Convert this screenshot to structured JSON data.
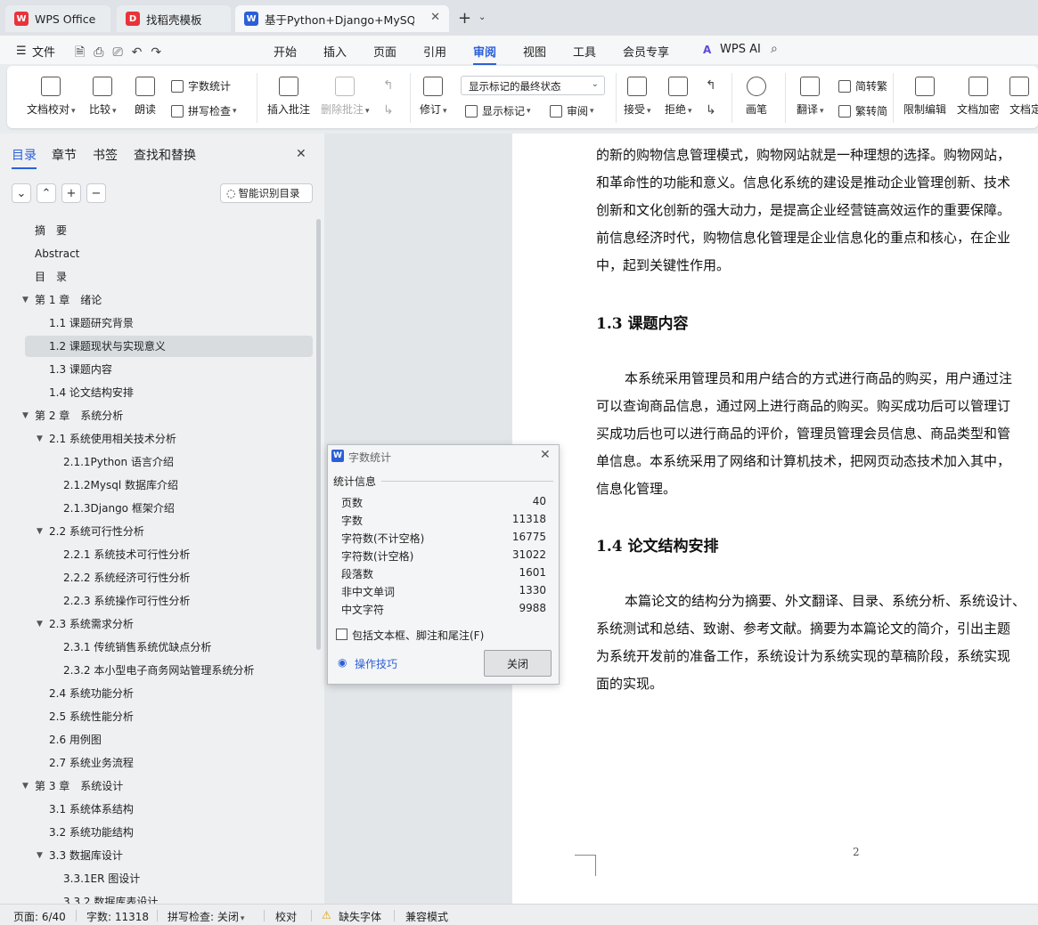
{
  "tabs": [
    {
      "label": "WPS Office",
      "icon": "wps-logo-icon"
    },
    {
      "label": "找稻壳模板",
      "icon": "docer-icon"
    },
    {
      "label": "基于Python+Django+MySQ",
      "icon": "writer-icon"
    }
  ],
  "menu": [
    "文件",
    "开始",
    "插入",
    "页面",
    "引用",
    "审阅",
    "视图",
    "工具",
    "会员专享",
    "WPS AI"
  ],
  "ribbon": {
    "doc_check": "文档校对",
    "compare": "比较",
    "read_aloud": "朗读",
    "word_count": "字数统计",
    "spell_check": "拼写检查",
    "insert_comment": "插入批注",
    "delete_comment": "删除批注",
    "revise": "修订",
    "markup_state": "显示标记的最终状态",
    "show_markup": "显示标记",
    "review_pane": "审阅",
    "accept": "接受",
    "reject": "拒绝",
    "pen": "画笔",
    "translate": "翻译",
    "to_traditional": "简转繁",
    "to_simplified": "繁转简",
    "restrict_edit": "限制编辑",
    "encrypt": "文档加密",
    "finalize": "文档定"
  },
  "nav": {
    "tabs": [
      "目录",
      "章节",
      "书签",
      "查找和替换"
    ],
    "smart_toc": "智能识别目录",
    "items": [
      "摘　要",
      "Abstract",
      "目　录",
      "第 1 章　绪论",
      "1.1 课题研究背景",
      "1.2 课题现状与实现意义",
      "1.3 课题内容",
      "1.4 论文结构安排",
      "第 2 章　系统分析",
      "2.1 系统使用相关技术分析",
      "2.1.1Python 语言介绍",
      "2.1.2Mysql 数据库介绍",
      "2.1.3Django 框架介绍",
      "2.2 系统可行性分析",
      "2.2.1 系统技术可行性分析",
      "2.2.2 系统经济可行性分析",
      "2.2.3 系统操作可行性分析",
      "2.3 系统需求分析",
      "2.3.1 传统销售系统优缺点分析",
      "2.3.2 本小型电子商务网站管理系统分析",
      "2.4 系统功能分析",
      "2.5 系统性能分析",
      "2.6 用例图",
      "2.7 系统业务流程",
      "第 3 章　系统设计",
      "3.1 系统体系结构",
      "3.2 系统功能结构",
      "3.3 数据库设计",
      "3.3.1ER 图设计",
      "3.3.2 数据库表设计"
    ]
  },
  "document": {
    "lines_a": [
      "的新的购物信息管理模式，购物网站就是一种理想的选择。购物网站，",
      "和革命性的功能和意义。信息化系统的建设是推动企业管理创新、技术",
      "创新和文化创新的强大动力，是提高企业经营链高效运作的重要保障。",
      "前信息经济时代，购物信息化管理是企业信息化的重点和核心，在企业",
      "中，起到关键性作用。"
    ],
    "heading_13": "1.3 课题内容",
    "lines_b": [
      "本系统采用管理员和用户结合的方式进行商品的购买，用户通过注",
      "可以查询商品信息，通过网上进行商品的购买。购买成功后可以管理订",
      "买成功后也可以进行商品的评价，管理员管理会员信息、商品类型和管",
      "单信息。本系统采用了网络和计算机技术，把网页动态技术加入其中，",
      "信息化管理。"
    ],
    "heading_14": "1.4 论文结构安排",
    "lines_c": [
      "本篇论文的结构分为摘要、外文翻译、目录、系统分析、系统设计、",
      "系统测试和总结、致谢、参考文献。摘要为本篇论文的简介，引出主题",
      "为系统开发前的准备工作，系统设计为系统实现的草稿阶段，系统实现",
      "面的实现。"
    ],
    "page_number": "2"
  },
  "dialog": {
    "title": "字数统计",
    "section": "统计信息",
    "rows": [
      {
        "label": "页数",
        "value": "40"
      },
      {
        "label": "字数",
        "value": "11318"
      },
      {
        "label": "字符数(不计空格)",
        "value": "16775"
      },
      {
        "label": "字符数(计空格)",
        "value": "31022"
      },
      {
        "label": "段落数",
        "value": "1601"
      },
      {
        "label": "非中文单词",
        "value": "1330"
      },
      {
        "label": "中文字符",
        "value": "9988"
      }
    ],
    "checkbox_label": "包括文本框、脚注和尾注(F)",
    "tips": "操作技巧",
    "close": "关闭"
  },
  "status": {
    "page": "页面: 6/40",
    "words": "字数: 11318",
    "spell": "拼写检查: 关闭",
    "proof": "校对",
    "missing_font": "缺失字体",
    "compat": "兼容模式"
  },
  "colors": {
    "accent": "#2b5fd9",
    "wps_red": "#e8333a"
  }
}
